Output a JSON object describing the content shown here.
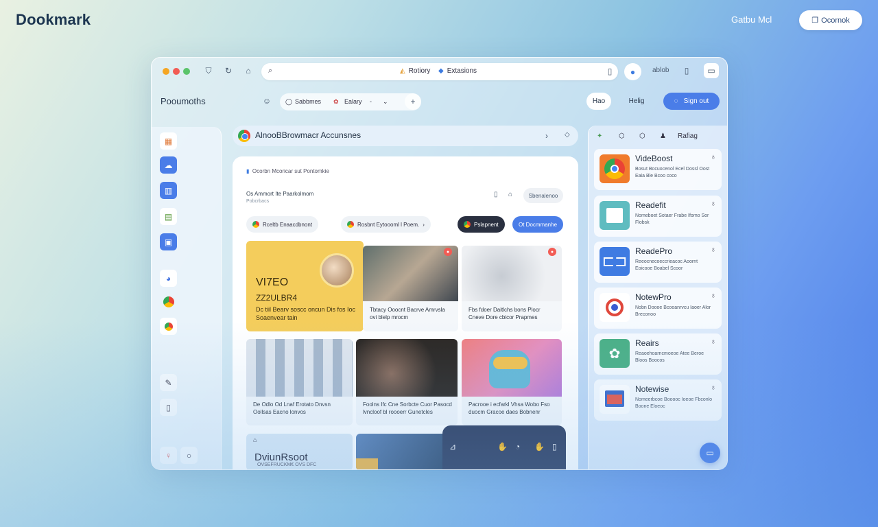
{
  "brand": "Dookmark",
  "top": {
    "link": "Gatbu Mcl",
    "button": "Ocornok"
  },
  "window": {
    "tabs": {
      "history": "Rotiory",
      "extensions": "Extasions"
    },
    "right_label": "ablob"
  },
  "header": {
    "title": "Pooumoths",
    "subtabs": [
      "Sabbmes",
      "Ealary"
    ],
    "btn_a": "Hao",
    "btn_b": "Helig",
    "sign_out": "Sign out"
  },
  "search": {
    "text": "AlnooBBrowmacr Accunsnes"
  },
  "panel": {
    "crumb": "Ocorbn  Mcoricar sut  Pontomkie",
    "line1": "Os Ammort Ite Paarkolmom",
    "line2": "Pobcrbacs",
    "save": "Sbenalenoo",
    "chips": [
      "Rceltb Enaacdbnont",
      "Rosbnt Eytoooml l Poem.",
      "Pslapnent",
      "Ot Docmmanhe"
    ]
  },
  "cards": {
    "video_title": "VI7EO",
    "video_date": "ZZ2ULBR4",
    "video_desc": "Dc tiil Bearv soscc oncun Dis fos Ioc Soaenvear tain",
    "c2_desc": "Tbtacy Ooocnt Bacrve Amrvsla ovi blelp mrocm",
    "c3_desc": "Fbs fdoer Daitlchs bons Plocr Cneve Dore cbicor Prapmes",
    "c4_desc": "De Odlo Od Lnaf Erotato Dnvsn Oollsas Eacno lonvos",
    "c5_desc": "Foolns Ifc Cne Sorbcte Cuor Pasocd lvncloof bl roooerr Gunetcles",
    "c6_desc": "Pacrooe i ecfarkl Vhsa Wobo Fso duocm Gracoe daes Bobnenr",
    "c7_title": "DviunRsoot",
    "c7_sub": "OVSEFRUCKM€ OVS DFC"
  },
  "extensions": [
    {
      "name": "VideBoost",
      "desc": "Bosut Bocuocenol Ecel Dossl Oost Eaia Ble Bcoo coco"
    },
    {
      "name": "Readefit",
      "desc": "Nomeboet Sotaer Frabe Ifomo Sor Flobsk"
    },
    {
      "name": "ReadePro",
      "desc": "Reeocnecoeccrieacoc Aoornt Eoicooe Boabel Scoor"
    },
    {
      "name": "NotewPro",
      "desc": "Nobn Doooe Bcooanrvcu Iaoer Alor Breconoo"
    },
    {
      "name": "Reairs",
      "desc": "Reaoehoarncmoeoe Atee Beroe Bloos Boocos"
    },
    {
      "name": "Notewise",
      "desc": "Nomeerbcoe Booooc Ioeoe Fbconlo Boone Eloeoc"
    }
  ],
  "right_panel": {
    "label": "Rafiag"
  },
  "colors": {
    "accent": "#4a7de8",
    "brand_text": "#1c3550"
  }
}
